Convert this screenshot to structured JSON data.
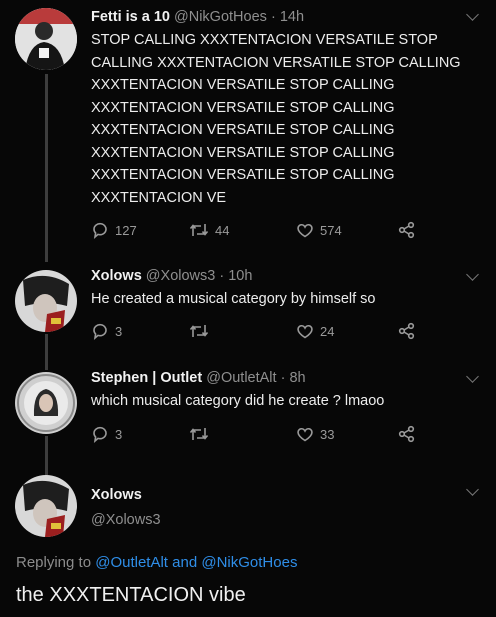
{
  "tweets": [
    {
      "name": "Fetti is a 10",
      "handle": "@NikGotHoes",
      "time": "14h",
      "text": "STOP CALLING XXXTENTACION VERSATILE STOP CALLING XXXTENTACION VERSATILE STOP CALLING XXXTENTACION VERSATILE STOP CALLING XXXTENTACION VERSATILE STOP CALLING XXXTENTACION VERSATILE STOP CALLING XXXTENTACION VERSATILE STOP CALLING XXXTENTACION VERSATILE STOP CALLING XXXTENTACION VE",
      "replies": "127",
      "retweets": "44",
      "likes": "574"
    },
    {
      "name": "Xolows",
      "handle": "@Xolows3",
      "time": "10h",
      "text": "He created a musical category by himself so",
      "replies": "3",
      "retweets": "",
      "likes": "24"
    },
    {
      "name": "Stephen | Outlet",
      "handle": "@OutletAlt",
      "time": "8h",
      "text": "which musical category did he create ? lmaoo",
      "replies": "3",
      "retweets": "",
      "likes": "33"
    }
  ],
  "focused": {
    "name": "Xolows",
    "handle": "@Xolows3",
    "replying_prefix": "Replying to",
    "mention_1": "@OutletAlt",
    "joiner": "and",
    "mention_2": "@NikGotHoes",
    "text": "the XXXTENTACION vibe"
  },
  "colors": {
    "background": "#070707",
    "link": "#2f8ee8",
    "muted": "#8f8f8f"
  },
  "icons": [
    "reply-icon",
    "retweet-icon",
    "like-icon",
    "share-icon",
    "caret-down-icon"
  ]
}
